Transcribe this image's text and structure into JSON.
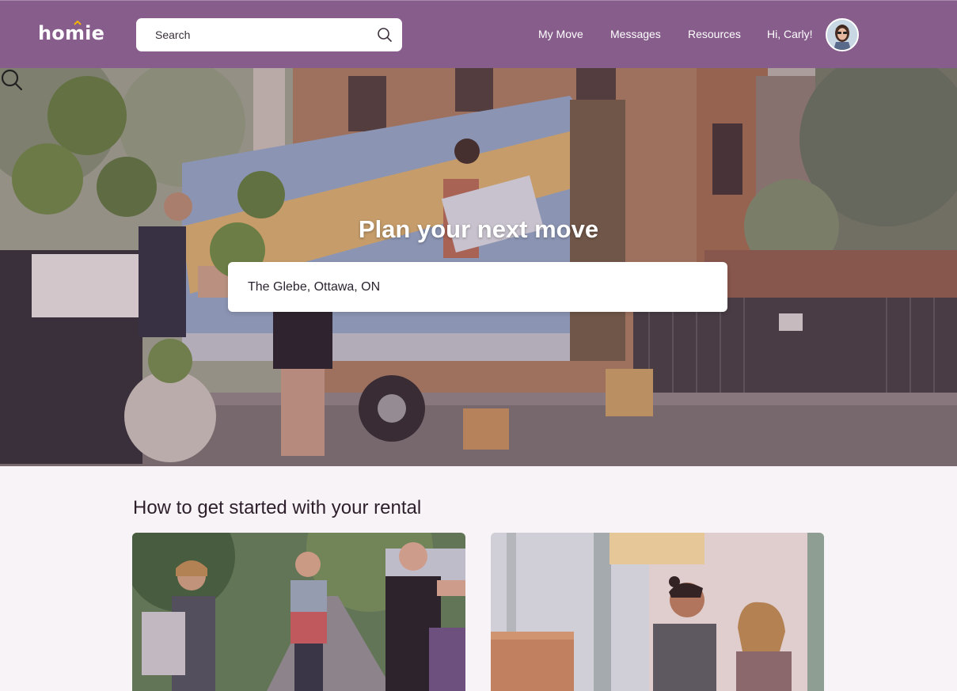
{
  "header": {
    "logo_text": "homie",
    "search": {
      "placeholder": "Search",
      "value": ""
    },
    "nav": [
      {
        "label": "My Move"
      },
      {
        "label": "Messages"
      },
      {
        "label": "Resources"
      }
    ],
    "greeting": "Hi, Carly!",
    "brand_color": "#875d8c"
  },
  "hero": {
    "title": "Plan your next move",
    "search": {
      "value": "The Glebe, Ottawa, ON"
    }
  },
  "section": {
    "title": "How to get started with your rental",
    "cards": [
      {
        "icon": "family-moving-photo"
      },
      {
        "icon": "couple-unpacking-photo"
      }
    ]
  }
}
